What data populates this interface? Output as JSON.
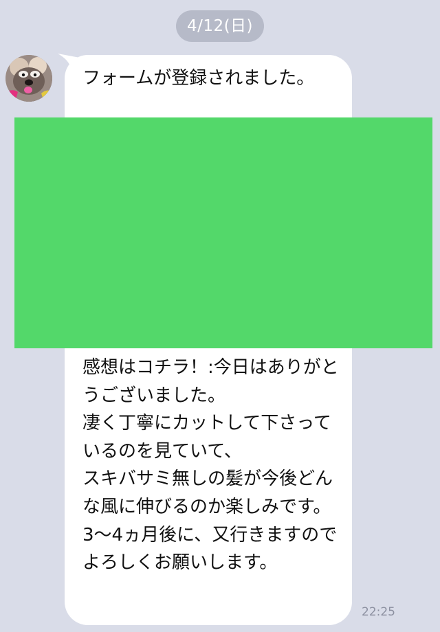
{
  "chat": {
    "date_label": "4/12(日)",
    "message": {
      "text_top": "フォームが登録されました。",
      "text_bottom": "感想はコチラ！:今日はありがとうございました。\n凄く丁寧にカットして下さっているのを見ていて、\nスキバサミ無しの髪が今後どんな風に伸びるのか楽しみです。\n3〜4ヵ月後に、又行きますのでよろしくお願いします。",
      "time": "22:25"
    },
    "sender": {
      "avatar_icon": "dog-avatar-icon"
    },
    "redaction_color": "#53d86a",
    "background_color": "#d9dce8"
  }
}
